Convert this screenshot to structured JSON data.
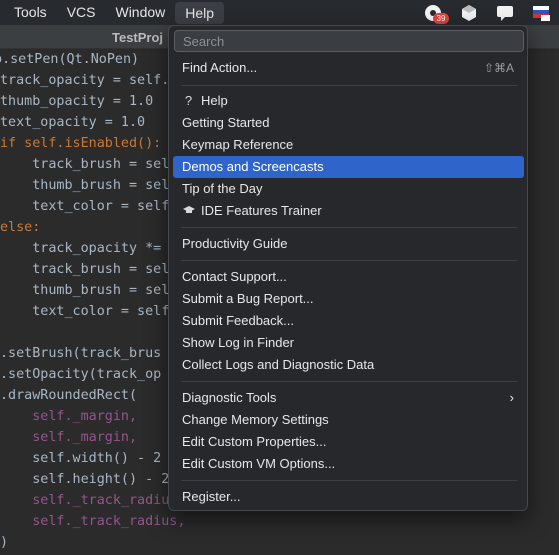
{
  "menubar": {
    "items": [
      "Tools",
      "VCS",
      "Window",
      "Help"
    ],
    "badge_count": "39",
    "flag_text": "RU"
  },
  "editor": {
    "tab_title": "TestProj",
    "lines": [
      ".setPen(Qt.NoPen)",
      "track_opacity = self.",
      "thumb_opacity = 1.0",
      "text_opacity = 1.0",
      "if self.isEnabled():",
      "    track_brush = sel",
      "    thumb_brush = sel",
      "    text_color = self",
      "else:",
      "    track_opacity *=",
      "    track_brush = sel",
      "    thumb_brush = sel",
      "    text_color = self",
      "",
      ".setBrush(track_brus",
      ".setOpacity(track_op",
      ".drawRoundedRect(",
      "    self._margin,",
      "    self._margin,",
      "    self.width() - 2",
      "    self.height() - 2",
      "    self._track_radiu",
      "    self._track_radius,",
      ")"
    ]
  },
  "help_menu": {
    "search_placeholder": "Search",
    "find_action": {
      "label": "Find Action...",
      "shortcut": "⇧⌘A"
    },
    "help": {
      "label": "Help",
      "icon": "?"
    },
    "getting_started": "Getting Started",
    "keymap_reference": "Keymap Reference",
    "demos_and_screencasts": "Demos and Screencasts",
    "tip_of_the_day": "Tip of the Day",
    "ide_features_trainer": "IDE Features Trainer",
    "productivity_guide": "Productivity Guide",
    "contact_support": "Contact Support...",
    "submit_bug_report": "Submit a Bug Report...",
    "submit_feedback": "Submit Feedback...",
    "show_log_in_finder": "Show Log in Finder",
    "collect_logs": "Collect Logs and Diagnostic Data",
    "diagnostic_tools": "Diagnostic Tools",
    "change_memory_settings": "Change Memory Settings",
    "edit_custom_properties": "Edit Custom Properties...",
    "edit_custom_vm_options": "Edit Custom VM Options...",
    "register": "Register...",
    "selected_item": "Demos and Screencasts",
    "selected_color": "#2f65ca"
  }
}
